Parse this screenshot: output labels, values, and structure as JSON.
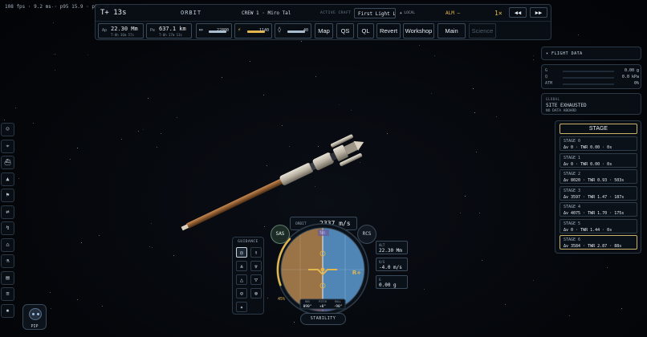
{
  "perf": {
    "text": "108 fps · 9.2 ms · p95 15.9 · p99 18.7"
  },
  "topbar": {
    "mission_time": "T+ 13s",
    "mode": "ORBIT",
    "crew": "CREW 1 · Miro Tal",
    "active_craft_label": "ACTIVE CRAFT",
    "active_craft": "First Light La",
    "local_label": "▲ LOCAL",
    "alarm": "ALM —",
    "warp": "1×",
    "rewind_label": "◀◀",
    "forward_label": "▶▶",
    "ap": {
      "key": "Ap",
      "value": "22.30 Mm",
      "sub": "T-0h 36m 57s"
    },
    "pe": {
      "key": "Pe",
      "value": "637.1 km",
      "sub": "T-0h 17m 13s"
    },
    "resources": [
      {
        "icon": "battery-icon",
        "glyph": "▭",
        "value": "22800",
        "fraction": 1.0,
        "color": "#a9bccd"
      },
      {
        "icon": "lightning-icon",
        "glyph": "⚡",
        "value": "1140",
        "fraction": 1.0,
        "color": "#e3b64d"
      },
      {
        "icon": "droplet-icon",
        "glyph": "◊",
        "value": "40",
        "fraction": 1.0,
        "color": "#a9bccd"
      }
    ],
    "buttons": [
      {
        "name": "map-button",
        "label": "Map",
        "enabled": true
      },
      {
        "name": "quicksave-button",
        "label": "QS",
        "enabled": true
      },
      {
        "name": "quickload-button",
        "label": "QL",
        "enabled": true
      },
      {
        "name": "revert-button",
        "label": "Revert",
        "enabled": true
      },
      {
        "name": "workshop-button",
        "label": "Workshop",
        "enabled": true
      },
      {
        "name": "main-button",
        "label": "Main",
        "enabled": true
      },
      {
        "name": "science-button",
        "label": "Science",
        "enabled": false
      }
    ]
  },
  "sidebar": {
    "items": [
      {
        "name": "sidebar-crew",
        "icon": "person-icon",
        "glyph": "☺"
      },
      {
        "name": "sidebar-target",
        "icon": "target-icon",
        "glyph": "⌖"
      },
      {
        "name": "sidebar-vessel",
        "icon": "boat-icon",
        "glyph": "⛴"
      },
      {
        "name": "sidebar-rocket",
        "icon": "rocket-icon",
        "glyph": "▲"
      },
      {
        "name": "sidebar-flag",
        "icon": "flag-icon",
        "glyph": "⚑"
      },
      {
        "name": "sidebar-transfer",
        "icon": "transfer-icon",
        "glyph": "⇄"
      },
      {
        "name": "sidebar-route",
        "icon": "route-icon",
        "glyph": "↯"
      },
      {
        "name": "sidebar-base",
        "icon": "base-icon",
        "glyph": "⌂"
      },
      {
        "name": "sidebar-lab",
        "icon": "flask-icon",
        "glyph": "⚗"
      },
      {
        "name": "sidebar-log",
        "icon": "clipboard-icon",
        "glyph": "▤"
      },
      {
        "name": "sidebar-notes",
        "icon": "document-icon",
        "glyph": "≡"
      },
      {
        "name": "sidebar-settings",
        "icon": "gear-icon",
        "glyph": "✹"
      }
    ],
    "pip_label": "PIP"
  },
  "flight_data": {
    "title": "▾ FLIGHT DATA",
    "rows": [
      {
        "key": "G",
        "value": "0.00 g"
      },
      {
        "key": "Q",
        "value": "0.0 kPa"
      },
      {
        "key": "ATM",
        "value": "0%"
      }
    ]
  },
  "global": {
    "label": "GLOBAL",
    "site": "SITE EXHAUSTED",
    "note": "NO DATA ABOARD"
  },
  "stages": {
    "header": "STAGE",
    "items": [
      {
        "name": "STAGE 0",
        "detail": "Δv 0 · TWR 0.00 · 0s",
        "active": false
      },
      {
        "name": "STAGE 1",
        "detail": "Δv 0 · TWR 0.00 · 0s",
        "active": false
      },
      {
        "name": "STAGE 2",
        "detail": "Δv 8020 · TWR 0.93 · 503s",
        "active": false
      },
      {
        "name": "STAGE 3",
        "detail": "Δv 3597 · TWR 1.47 · 187s",
        "active": false
      },
      {
        "name": "STAGE 4",
        "detail": "Δv 4075 · TWR 1.70 · 175s",
        "active": false
      },
      {
        "name": "STAGE 5",
        "detail": "Δv 0 · TWR 1.44 · 0s",
        "active": false
      },
      {
        "name": "STAGE 6",
        "detail": "Δv 3584 · TWR 2.87 · 88s",
        "active": true
      }
    ]
  },
  "guidance": {
    "title": "GUIDANCE",
    "buttons": [
      {
        "name": "stability-assist",
        "glyph": "◎",
        "active": true
      },
      {
        "name": "prograde",
        "glyph": "↑",
        "active": false
      },
      {
        "name": "normal",
        "glyph": "⩓",
        "active": false
      },
      {
        "name": "antinormal",
        "glyph": "⩔",
        "active": false
      },
      {
        "name": "radial-in",
        "glyph": "△",
        "active": false
      },
      {
        "name": "radial-out",
        "glyph": "▽",
        "active": false
      },
      {
        "name": "target",
        "glyph": "⊙",
        "active": false
      },
      {
        "name": "anti-target",
        "glyph": "⊗",
        "active": false
      },
      {
        "name": "maneuver",
        "glyph": "✦",
        "active": false
      }
    ]
  },
  "navball": {
    "sas_label": "SAS",
    "rcs_label": "RCS",
    "orbit_label": "ORBIT",
    "speed": "2337 m/s",
    "throttle_label": "45%",
    "throttle": 0.45,
    "marker_r": "R+",
    "marker_top": "Nn",
    "hdg_key": "HDG",
    "hdg": "090°",
    "pitch_key": "PITCH",
    "pitch": "+0°",
    "roll_key": "ROLL",
    "roll": "-90°",
    "stability_label": "STABILITY",
    "colors": {
      "sky": "#4f86b6",
      "ground": "#9a7446",
      "accent": "#e3b64d"
    }
  },
  "readouts": {
    "alt": {
      "key": "ALT",
      "value": "22.30 Mm"
    },
    "vs": {
      "key": "V/S",
      "value": "-4.0 m/s"
    },
    "g": {
      "key": "G",
      "value": "0.00 g"
    }
  }
}
